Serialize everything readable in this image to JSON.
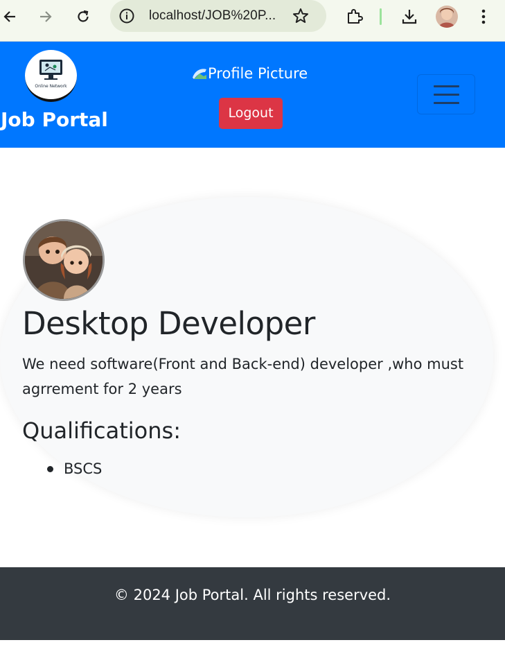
{
  "browser": {
    "url": "localhost/JOB%20P...",
    "icons": [
      "back-icon",
      "forward-icon",
      "reload-icon",
      "site-info-icon",
      "bookmark-star-icon",
      "extensions-icon",
      "download-icon",
      "profile-avatar",
      "menu-kebab-icon"
    ]
  },
  "navbar": {
    "brand": "Job Portal",
    "logo_text": "Online Network",
    "profile_picture_alt": "Profile Picture",
    "logout_label": "Logout",
    "toggler_icon": "hamburger-icon",
    "background_color": "#0077ff",
    "logout_color": "#dc3545"
  },
  "job": {
    "title": "Desktop Developer",
    "description": "We need software(Front and Back-end) developer ,who must agrrement for 2 years",
    "qualifications_heading": "Qualifications:",
    "qualifications": [
      "BSCS"
    ]
  },
  "footer": {
    "text": "© 2024 Job Portal. All rights reserved.",
    "background_color": "#343a40"
  }
}
